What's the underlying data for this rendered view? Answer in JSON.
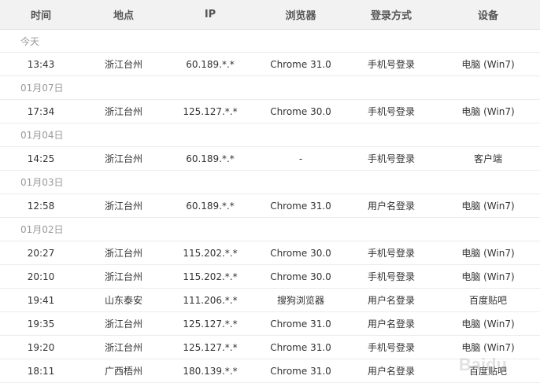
{
  "header": {
    "time": "时间",
    "location": "地点",
    "ip": "IP",
    "browser": "浏览器",
    "login_method": "登录方式",
    "device": "设备"
  },
  "groups": [
    {
      "date": "今天",
      "records": [
        {
          "time": "13:43",
          "location": "浙江台州",
          "ip": "60.189.*.*",
          "browser": "Chrome 31.0",
          "login_method": "手机号登录",
          "device": "电脑 (Win7)"
        }
      ]
    },
    {
      "date": "01月07日",
      "records": [
        {
          "time": "17:34",
          "location": "浙江台州",
          "ip": "125.127.*.*",
          "browser": "Chrome 30.0",
          "login_method": "手机号登录",
          "device": "电脑 (Win7)"
        }
      ]
    },
    {
      "date": "01月04日",
      "records": [
        {
          "time": "14:25",
          "location": "浙江台州",
          "ip": "60.189.*.*",
          "browser": "-",
          "login_method": "手机号登录",
          "device": "客户端"
        }
      ]
    },
    {
      "date": "01月03日",
      "records": [
        {
          "time": "12:58",
          "location": "浙江台州",
          "ip": "60.189.*.*",
          "browser": "Chrome 31.0",
          "login_method": "用户名登录",
          "device": "电脑 (Win7)"
        }
      ]
    },
    {
      "date": "01月02日",
      "records": [
        {
          "time": "20:27",
          "location": "浙江台州",
          "ip": "115.202.*.*",
          "browser": "Chrome 30.0",
          "login_method": "手机号登录",
          "device": "电脑 (Win7)"
        },
        {
          "time": "20:10",
          "location": "浙江台州",
          "ip": "115.202.*.*",
          "browser": "Chrome 30.0",
          "login_method": "手机号登录",
          "device": "电脑 (Win7)"
        },
        {
          "time": "19:41",
          "location": "山东泰安",
          "ip": "111.206.*.*",
          "browser": "搜狗浏览器",
          "login_method": "用户名登录",
          "device": "百度贴吧"
        },
        {
          "time": "19:35",
          "location": "浙江台州",
          "ip": "125.127.*.*",
          "browser": "Chrome 31.0",
          "login_method": "用户名登录",
          "device": "电脑 (Win7)"
        },
        {
          "time": "19:20",
          "location": "浙江台州",
          "ip": "125.127.*.*",
          "browser": "Chrome 31.0",
          "login_method": "手机号登录",
          "device": "电脑 (Win7)"
        },
        {
          "time": "18:11",
          "location": "广西梧州",
          "ip": "180.139.*.*",
          "browser": "Chrome 31.0",
          "login_method": "用户名登录",
          "device": "百度贴吧"
        }
      ]
    }
  ],
  "watermark": "Baidu"
}
